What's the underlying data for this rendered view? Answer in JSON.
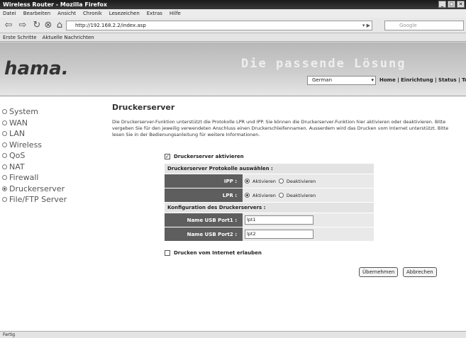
{
  "window": {
    "title": "Wireless Router - Mozilla Firefox",
    "minimize": "_",
    "maximize": "□",
    "close": "✕"
  },
  "menu": [
    "Datei",
    "Bearbeiten",
    "Ansicht",
    "Chronik",
    "Lesezeichen",
    "Extras",
    "Hilfe"
  ],
  "nav": {
    "url": "http://192.168.2.2/index.asp",
    "search_placeholder": "Google"
  },
  "bookmarks": [
    "Erste Schritte",
    "Aktuelle Nachrichten"
  ],
  "header": {
    "logo": "hama.",
    "tagline": "Die passende Lösung",
    "language": "German",
    "links": "Home | Einrichtung | Status | Tool"
  },
  "sidebar": [
    {
      "label": "System",
      "selected": false
    },
    {
      "label": "WAN",
      "selected": false
    },
    {
      "label": "LAN",
      "selected": false
    },
    {
      "label": "Wireless",
      "selected": false
    },
    {
      "label": "QoS",
      "selected": false
    },
    {
      "label": "NAT",
      "selected": false
    },
    {
      "label": "Firewall",
      "selected": false
    },
    {
      "label": "Druckerserver",
      "selected": true
    },
    {
      "label": "File/FTP Server",
      "selected": false
    }
  ],
  "main": {
    "title": "Druckerserver",
    "description": "Die Druckerserver-Funktion unterstützt die Protokolle LPR und IPP. Sie können die Druckerserver-Funktion hier aktivieren oder deaktivieren. Bitte vergeben Sie für den jeweilig verwendeten Anschluss einen Druckerschleifennamen. Ausserdem wird das Drucken vom Internet unterstützt. Bitte lesen Sie in der Bedienungsanleitung für weitere Informationen.",
    "enable_label": "Druckerserver aktivieren",
    "enable_checked": true,
    "protocols_header": "Druckerserver Protokolle auswählen :",
    "ipp_label": "IPP :",
    "lpr_label": "LPR :",
    "activate": "Aktivieren",
    "deactivate": "Deaktivieren",
    "ipp_value": "Aktivieren",
    "lpr_value": "Aktivieren",
    "config_header": "Konfiguration des Druckerservers :",
    "port1_label": "Name USB Port1 :",
    "port1_value": "lpt1",
    "port2_label": "Name USB Port2 :",
    "port2_value": "lpt2",
    "internet_label": "Drucken vom Internet erlauben",
    "internet_checked": false,
    "apply": "Übernehmen",
    "cancel": "Abbrechen"
  },
  "status": "Fertig"
}
